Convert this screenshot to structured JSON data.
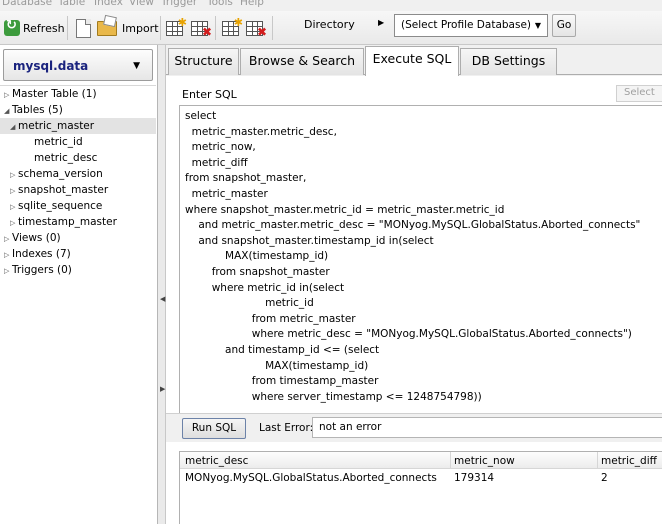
{
  "menu": [
    "Database",
    "Table",
    "Index",
    "View",
    "Trigger",
    "Tools",
    "Help"
  ],
  "toolbar": {
    "refresh_label": "Refresh",
    "import_label": "Import",
    "directory_label": "Directory",
    "profile_combo_value": "(Select Profile Database)",
    "go_label": "Go"
  },
  "database": {
    "name": "mysql.data"
  },
  "tree": [
    {
      "label": "Master Table (1)",
      "level": 0,
      "toggle": "collapsed"
    },
    {
      "label": "Tables (5)",
      "level": 0,
      "toggle": "expanded"
    },
    {
      "label": "metric_master",
      "level": 1,
      "toggle": "expanded",
      "selected": true
    },
    {
      "label": "metric_id",
      "level": 2,
      "toggle": "none"
    },
    {
      "label": "metric_desc",
      "level": 2,
      "toggle": "none"
    },
    {
      "label": "schema_version",
      "level": 1,
      "toggle": "collapsed"
    },
    {
      "label": "snapshot_master",
      "level": 1,
      "toggle": "collapsed"
    },
    {
      "label": "sqlite_sequence",
      "level": 1,
      "toggle": "collapsed"
    },
    {
      "label": "timestamp_master",
      "level": 1,
      "toggle": "collapsed"
    },
    {
      "label": "Views (0)",
      "level": 0,
      "toggle": "collapsed"
    },
    {
      "label": "Indexes (7)",
      "level": 0,
      "toggle": "collapsed"
    },
    {
      "label": "Triggers (0)",
      "level": 0,
      "toggle": "collapsed"
    }
  ],
  "tabs": [
    {
      "label": "Structure",
      "active": false
    },
    {
      "label": "Browse & Search",
      "active": false
    },
    {
      "label": "Execute SQL",
      "active": true
    },
    {
      "label": "DB Settings",
      "active": false
    }
  ],
  "sql_editor": {
    "label": "Enter SQL",
    "select_button": "Select",
    "lines": [
      "select",
      "  metric_master.metric_desc,",
      "  metric_now,",
      "  metric_diff",
      "from snapshot_master,",
      "  metric_master",
      "where snapshot_master.metric_id = metric_master.metric_id",
      "    and metric_master.metric_desc = \"MONyog.MySQL.GlobalStatus.Aborted_connects\"",
      "    and snapshot_master.timestamp_id in(select",
      "            MAX(timestamp_id)",
      "        from snapshot_master",
      "        where metric_id in(select",
      "                        metric_id",
      "                    from metric_master",
      "                    where metric_desc = \"MONyog.MySQL.GlobalStatus.Aborted_connects\")",
      "            and timestamp_id <= (select",
      "                        MAX(timestamp_id)",
      "                    from timestamp_master",
      "                    where server_timestamp <= 1248754798))"
    ]
  },
  "run": {
    "run_label": "Run SQL",
    "last_error_label": "Last Error:",
    "last_error_value": "not an error"
  },
  "results": {
    "columns": [
      "metric_desc",
      "metric_now",
      "metric_diff"
    ],
    "rows": [
      [
        "MONyog.MySQL.GlobalStatus.Aborted_connects",
        "179314",
        "2"
      ]
    ]
  }
}
